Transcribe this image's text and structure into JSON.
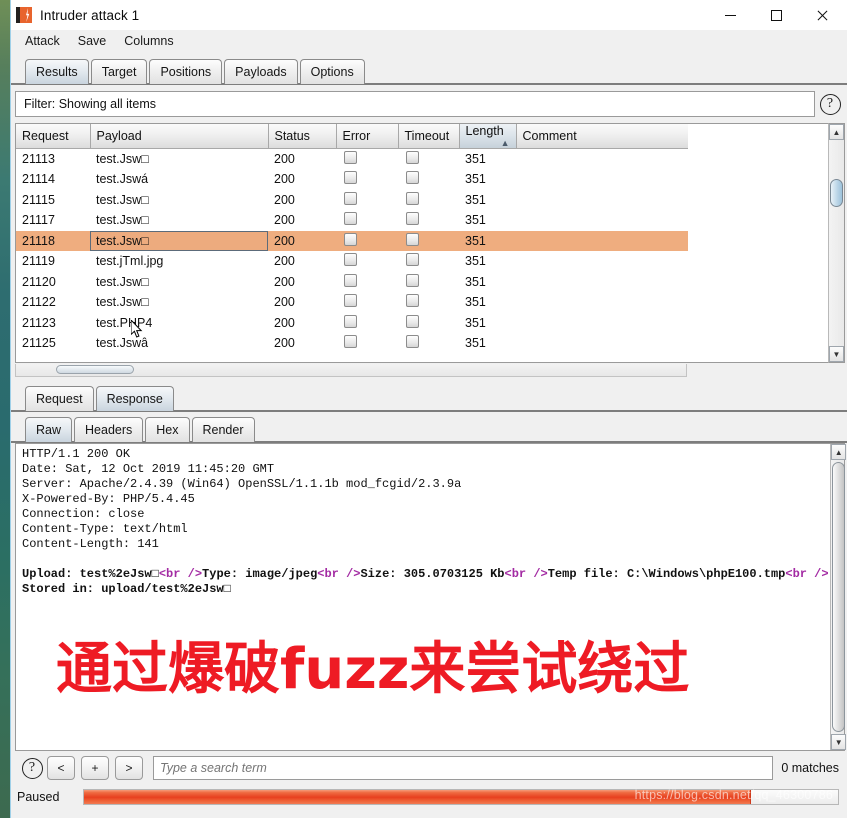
{
  "window": {
    "title": "Intruder attack 1",
    "icon": "burp-suite-icon",
    "minimize": "—",
    "maximize": "□",
    "close": "✕"
  },
  "menubar": {
    "items": [
      "Attack",
      "Save",
      "Columns"
    ]
  },
  "main_tabs": {
    "items": [
      "Results",
      "Target",
      "Positions",
      "Payloads",
      "Options"
    ],
    "active": "Results"
  },
  "filter": {
    "text": "Filter: Showing all items",
    "help_icon": "question-mark-icon"
  },
  "results_table": {
    "columns": [
      "Request",
      "Payload",
      "Status",
      "Error",
      "Timeout",
      "Length",
      "Comment"
    ],
    "sorted_column": "Length",
    "sort_arrow": "▲",
    "rows": [
      {
        "request": "21113",
        "payload": "test.Jsw□",
        "status": "200",
        "error": false,
        "timeout": false,
        "length": "351",
        "comment": "",
        "selected": false
      },
      {
        "request": "21114",
        "payload": "test.Jswá",
        "status": "200",
        "error": false,
        "timeout": false,
        "length": "351",
        "comment": "",
        "selected": false
      },
      {
        "request": "21115",
        "payload": "test.Jsw□",
        "status": "200",
        "error": false,
        "timeout": false,
        "length": "351",
        "comment": "",
        "selected": false
      },
      {
        "request": "21117",
        "payload": "test.Jsw□",
        "status": "200",
        "error": false,
        "timeout": false,
        "length": "351",
        "comment": "",
        "selected": false
      },
      {
        "request": "21118",
        "payload": "test.Jsw□",
        "status": "200",
        "error": false,
        "timeout": false,
        "length": "351",
        "comment": "",
        "selected": true
      },
      {
        "request": "21119",
        "payload": "test.jTml.jpg",
        "status": "200",
        "error": false,
        "timeout": false,
        "length": "351",
        "comment": "",
        "selected": false
      },
      {
        "request": "21120",
        "payload": "test.Jsw□",
        "status": "200",
        "error": false,
        "timeout": false,
        "length": "351",
        "comment": "",
        "selected": false
      },
      {
        "request": "21122",
        "payload": "test.Jsw□",
        "status": "200",
        "error": false,
        "timeout": false,
        "length": "351",
        "comment": "",
        "selected": false
      },
      {
        "request": "21123",
        "payload": "test.PHP4",
        "status": "200",
        "error": false,
        "timeout": false,
        "length": "351",
        "comment": "",
        "selected": false
      },
      {
        "request": "21125",
        "payload": "test.Jswâ",
        "status": "200",
        "error": false,
        "timeout": false,
        "length": "351",
        "comment": "",
        "selected": false
      }
    ]
  },
  "message_tabs": {
    "items": [
      "Request",
      "Response"
    ],
    "active": "Response"
  },
  "view_tabs": {
    "items": [
      "Raw",
      "Headers",
      "Hex",
      "Render"
    ],
    "active": "Raw"
  },
  "response": {
    "headers": [
      "HTTP/1.1 200 OK",
      "Date: Sat, 12 Oct 2019 11:45:20 GMT",
      "Server: Apache/2.4.39 (Win64) OpenSSL/1.1.1b mod_fcgid/2.3.9a",
      "X-Powered-By: PHP/5.4.45",
      "Connection: close",
      "Content-Type: text/html",
      "Content-Length: 141"
    ],
    "body_segments": [
      {
        "text": "Upload: test%2eJsw□",
        "kind": "bold"
      },
      {
        "text": "<br />",
        "kind": "tag"
      },
      {
        "text": "Type: image/jpeg",
        "kind": "bold"
      },
      {
        "text": "<br />",
        "kind": "tag"
      },
      {
        "text": "Size: 305.0703125 Kb",
        "kind": "bold"
      },
      {
        "text": "<br />",
        "kind": "tag"
      },
      {
        "text": "Temp file: C:\\Windows\\phpE100.tmp",
        "kind": "bold"
      },
      {
        "text": "<br />",
        "kind": "tag"
      },
      {
        "text": "Stored in: upload/test%2eJsw□",
        "kind": "bold"
      }
    ]
  },
  "annotation": {
    "text": "通过爆破fuzz来尝试绕过",
    "color": "#ee1b24"
  },
  "search": {
    "help_icon": "question-mark-icon",
    "prev_label": "<",
    "add_label": "+",
    "next_label": ">",
    "placeholder": "Type a search term",
    "value": "",
    "match_count": "0 matches"
  },
  "status": {
    "label": "Paused",
    "progress_percent": 88.5,
    "progress_color": "#e8401f"
  },
  "watermark": {
    "text": "https://blog.csdn.net/qq_46300786"
  }
}
